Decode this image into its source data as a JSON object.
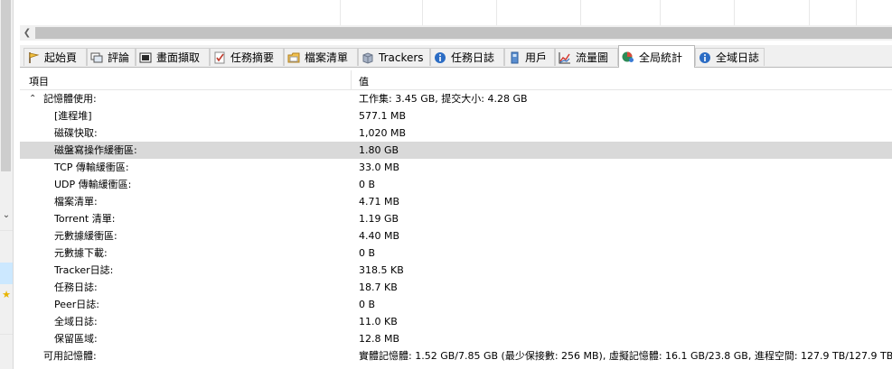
{
  "tabs": [
    {
      "label": "起始頁",
      "icon": "start-page-icon"
    },
    {
      "label": "評論",
      "icon": "comments-icon"
    },
    {
      "label": "畫面擷取",
      "icon": "screenshot-icon"
    },
    {
      "label": "任務摘要",
      "icon": "task-summary-icon"
    },
    {
      "label": "檔案清單",
      "icon": "file-list-icon"
    },
    {
      "label": "Trackers",
      "icon": "trackers-icon"
    },
    {
      "label": "任務日誌",
      "icon": "task-log-icon"
    },
    {
      "label": "用戶",
      "icon": "peers-icon"
    },
    {
      "label": "流量圖",
      "icon": "traffic-graph-icon"
    },
    {
      "label": "全局統計",
      "icon": "global-stats-icon"
    },
    {
      "label": "全域日誌",
      "icon": "global-log-icon"
    }
  ],
  "active_tab": "全局統計",
  "list": {
    "header_item": "項目",
    "header_value": "值",
    "rows": [
      {
        "item": "記憶體使用:",
        "value": "工作集: 3.45 GB, 提交大小: 4.28 GB"
      },
      {
        "item": "[進程堆]",
        "value": "577.1 MB"
      },
      {
        "item": "磁碟快取:",
        "value": "1,020 MB"
      },
      {
        "item": "磁盤寫操作緩衝區:",
        "value": "1.80 GB"
      },
      {
        "item": "TCP 傳輸緩衝區:",
        "value": "33.0 MB"
      },
      {
        "item": "UDP 傳輸緩衝區:",
        "value": "0 B"
      },
      {
        "item": "檔案清單:",
        "value": "4.71 MB"
      },
      {
        "item": "Torrent 清單:",
        "value": "1.19 GB"
      },
      {
        "item": "元數據緩衝區:",
        "value": "4.40 MB"
      },
      {
        "item": "元數據下載:",
        "value": "0 B"
      },
      {
        "item": "Tracker日誌:",
        "value": "318.5 KB"
      },
      {
        "item": "任務日誌:",
        "value": "18.7 KB"
      },
      {
        "item": "Peer日誌:",
        "value": "0 B"
      },
      {
        "item": "全域日誌:",
        "value": "11.0 KB"
      },
      {
        "item": "保留區域:",
        "value": "12.8 MB"
      },
      {
        "item": "可用記憶體:",
        "value": "實體記憶體: 1.52 GB/7.85 GB (最少保接數: 256 MB), 虛擬記憶體: 16.1 GB/23.8 GB, 進程空間: 127.9 TB/127.9 TB"
      }
    ]
  }
}
